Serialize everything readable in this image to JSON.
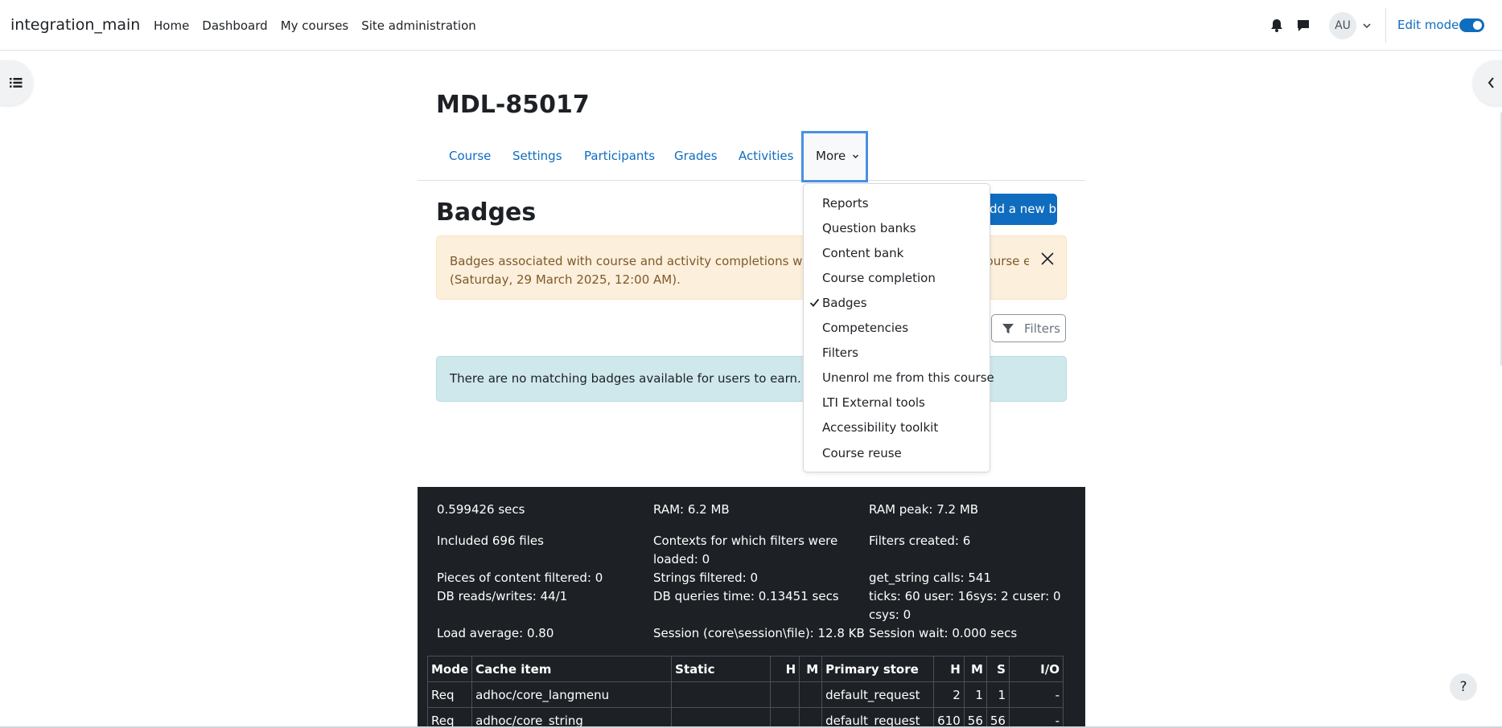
{
  "navbar": {
    "brand": "integration_main",
    "links": [
      "Home",
      "Dashboard",
      "My courses",
      "Site administration"
    ],
    "avatar_initials": "AU",
    "edit_mode_label": "Edit mode",
    "edit_mode_on": true
  },
  "course": {
    "title": "MDL-85017",
    "tabs": [
      "Course",
      "Settings",
      "Participants",
      "Grades",
      "Activities"
    ],
    "more_label": "More"
  },
  "page": {
    "heading": "Badges",
    "add_badge_label": "Add a new badge",
    "warning_text": "Badges associated with course and activity completions will not be issued because the course has ended (Saturday, 29 March 2025, 12:00 AM).",
    "warning_line1": "Badges associated with course and activity completions will not be issued because the course end date has passed",
    "warning_line2": "(Saturday, 29 March 2025, 12:00 AM).",
    "filters_label": "Filters",
    "info_text": "There are no matching badges available for users to earn."
  },
  "more_menu": {
    "items": [
      {
        "label": "Reports",
        "checked": false
      },
      {
        "label": "Question banks",
        "checked": false
      },
      {
        "label": "Content bank",
        "checked": false
      },
      {
        "label": "Course completion",
        "checked": false
      },
      {
        "label": "Badges",
        "checked": true
      },
      {
        "label": "Competencies",
        "checked": false
      },
      {
        "label": "Filters",
        "checked": false
      },
      {
        "label": "Unenrol me from this course",
        "checked": false
      },
      {
        "label": "LTI External tools",
        "checked": false
      },
      {
        "label": "Accessibility toolkit",
        "checked": false
      },
      {
        "label": "Course reuse",
        "checked": false
      }
    ]
  },
  "perf": {
    "time": "0.599426 secs",
    "ram": "RAM: 6.2 MB",
    "ram_peak": "RAM peak: 7.2 MB",
    "included_files": "Included 696 files",
    "contexts_filters": "Contexts for which filters were loaded: 0",
    "filters_created": "Filters created: 6",
    "content_filtered": "Pieces of content filtered: 0",
    "strings_filtered": "Strings filtered: 0",
    "get_string": "get_string calls: 541",
    "db_rw": "DB reads/writes: 44/1",
    "db_time": "DB queries time: 0.13451 secs",
    "ticks": "ticks: 60 user: 16sys: 2 cuser: 0 csys: 0",
    "load_avg": "Load average: 0.80",
    "session": "Session (core\\session\\file): 12.8 KB",
    "session_wait": "Session wait: 0.000 secs",
    "cache_headers": [
      "Mode",
      "Cache item",
      "Static",
      "H",
      "M",
      "Primary store",
      "H",
      "M",
      "S",
      "I/O"
    ],
    "cache_rows": [
      [
        "Req",
        "adhoc/core_langmenu",
        "",
        "",
        "",
        "default_request",
        "2",
        "1",
        "1",
        "-"
      ],
      [
        "Req",
        "adhoc/core_string",
        "",
        "",
        "",
        "default_request",
        "610",
        "56",
        "56",
        "-"
      ]
    ]
  },
  "help_label": "?"
}
